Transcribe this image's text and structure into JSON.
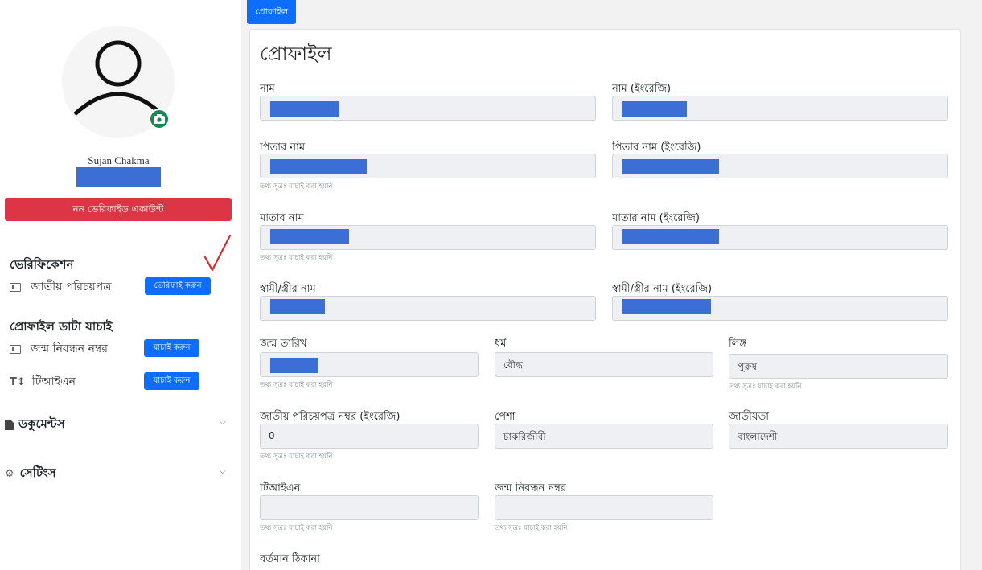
{
  "sidebar": {
    "user_name": "Sujan Chakma",
    "status_label": "নন ভেরিফাইড একাউন্ট",
    "verification": {
      "title": "ভেরিফিকেশন",
      "nid_label": "জাতীয় পরিচয়পত্র",
      "nid_button": "ভেরিফাই করুন"
    },
    "profile_check": {
      "title": "প্রোফাইল ডাটা যাচাই",
      "birth_label": "জন্ম নিবন্ধন নম্বর",
      "birth_button": "যাচাই করুন",
      "tin_label": "টিআইএন",
      "tin_button": "যাচাই করুন"
    },
    "documents_label": "ডকুমেন্টস",
    "settings_label": "সেটিংস",
    "colors": {
      "status": "#dc3545",
      "primary": "#0d6efd",
      "camera": "#198754"
    }
  },
  "main": {
    "tab_label": "প্রোফাইল",
    "card_title": "প্রোফাইল",
    "hint_text": "তথ্য সূত্রঃ যাচাই করা হয়নি",
    "fields": {
      "name": {
        "label": "নাম"
      },
      "name_en": {
        "label": "নাম (ইংরেজি)"
      },
      "father": {
        "label": "পিতার নাম"
      },
      "father_en": {
        "label": "পিতার নাম (ইংরেজি)"
      },
      "mother": {
        "label": "মাতার নাম"
      },
      "mother_en": {
        "label": "মাতার নাম (ইংরেজি)"
      },
      "spouse": {
        "label": "স্বামী/স্ত্রীর নাম"
      },
      "spouse_en": {
        "label": "স্বামী/স্ত্রীর নাম (ইংরেজি)"
      },
      "dob": {
        "label": "জন্ম তারিখ"
      },
      "religion": {
        "label": "ধর্ম",
        "value": "বৌদ্ধ"
      },
      "gender": {
        "label": "লিঙ্গ",
        "value": "পুরুষ"
      },
      "nid_en": {
        "label": "জাতীয় পরিচয়পত্র নম্বর (ইংরেজি)",
        "value": "0"
      },
      "occupation": {
        "label": "পেশা",
        "value": "চাকরিজীবী"
      },
      "nationality": {
        "label": "জাতীয়তা",
        "value": "বাংলাদেশী"
      },
      "tin": {
        "label": "টিআইএন",
        "value": ""
      },
      "birth_reg": {
        "label": "জন্ম নিবন্ধন নম্বর",
        "value": ""
      },
      "present_address": {
        "label": "বর্তমান ঠিকানা"
      }
    }
  }
}
